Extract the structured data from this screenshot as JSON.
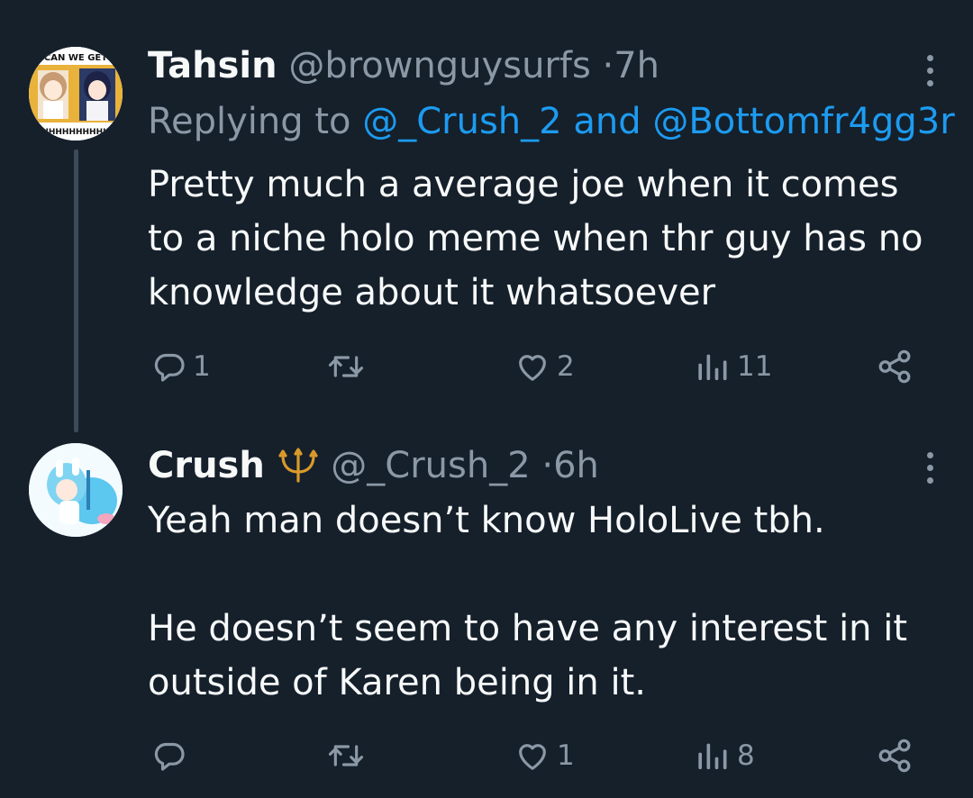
{
  "tweets": [
    {
      "name": "Tahsin",
      "handle": "@brownguysurfs",
      "time": "7h",
      "avatar_caption_top": "CAN WE GET",
      "avatar_caption_bottom": "HHHHHHHHHH",
      "replying_prefix": "Replying to",
      "replying_mention_1": "@_Crush_2",
      "replying_and": "and",
      "replying_mention_2": "@Bottomfr4gg3r",
      "text": "Pretty much a average joe when it comes to a niche holo meme when thr guy has no knowledge about it whatsoever",
      "replies": "1",
      "retweets": "",
      "likes": "2",
      "views": "11"
    },
    {
      "name": "Crush",
      "badge_emoji": "🔱",
      "handle": "@_Crush_2",
      "time": "6h",
      "text_para_1": "Yeah man doesn’t know HoloLive tbh.",
      "text_para_2": "He doesn’t seem to have any interest in it outside of Karen being in it.",
      "replies": "",
      "retweets": "",
      "likes": "1",
      "views": "8"
    }
  ],
  "colors": {
    "background": "#15202b",
    "text": "#f7f9f9",
    "secondary": "#8b98a5",
    "mention": "#1d9bf0",
    "thread_line": "#3d4a57",
    "trident": "#d99a2b"
  },
  "icons": [
    "reply-icon",
    "retweet-icon",
    "like-icon",
    "views-icon",
    "share-icon",
    "more-icon",
    "trident-icon"
  ]
}
